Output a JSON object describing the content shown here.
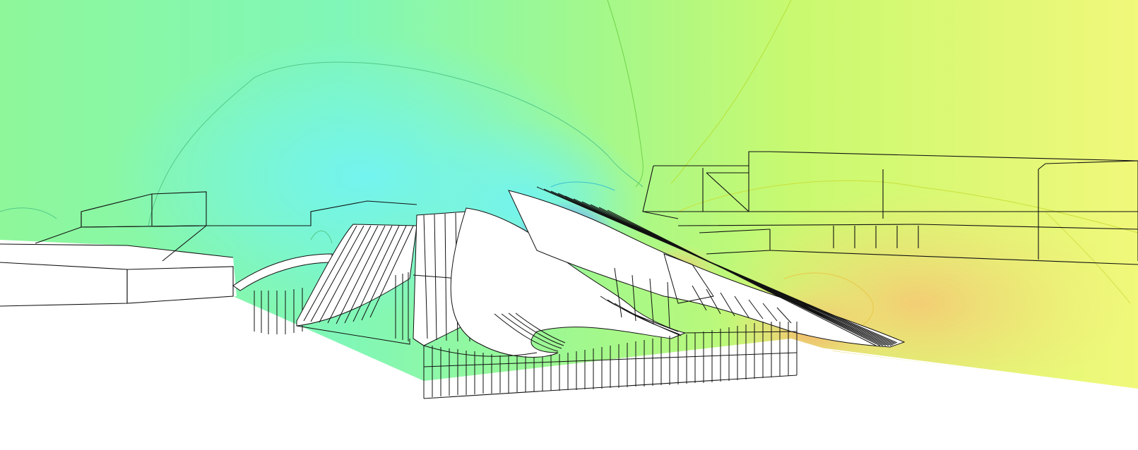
{
  "view": {
    "kind": "wind-simulation-3d-render",
    "description_visible_text": ""
  },
  "colors": {
    "field_green": "#7ef7a5",
    "field_lightgreen": "#a6f98a",
    "field_cyan": "#7af7e6",
    "field_yellow": "#eaf87a",
    "field_yellowgreen": "#c8f96e",
    "field_orange": "#f5d47a",
    "field_hot": "#f0b070",
    "field_blue": "#7a82f5",
    "contour_line": "#52c87a",
    "contour_yellow": "#d6e84a",
    "ground": "#ffffff",
    "building_stroke": "#111111"
  },
  "icons": [
    "building-wireframe",
    "terrain-ground",
    "contour-isoline"
  ]
}
